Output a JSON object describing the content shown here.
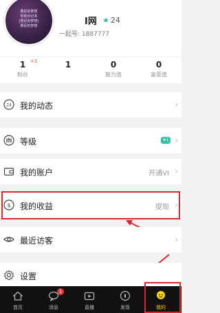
{
  "profile": {
    "nickname": "I网",
    "level": "24",
    "uid_prefix": "一起号:",
    "uid_value": "1887777",
    "avatar_text": [
      "赛尼的梦想",
      "你的日记本",
      "[赛尼的梦想]",
      "赛尼的梦想"
    ]
  },
  "stats": [
    {
      "num": "1",
      "label": "粉丝",
      "plus": "+1"
    },
    {
      "num": "1",
      "label": ""
    },
    {
      "num": "0",
      "label": "魅力值"
    },
    {
      "num": "0",
      "label": "富豪值"
    }
  ],
  "menu": {
    "dynamics": "我的动态",
    "level": "等级",
    "level_badge": "★1",
    "account": "我的账户",
    "account_right": "开通VI",
    "income": "我的收益",
    "income_right": "提现",
    "visitors": "最近访客",
    "settings": "设置"
  },
  "tabs": [
    {
      "label": "首页"
    },
    {
      "label": "消息",
      "badge": "1"
    },
    {
      "label": "直播"
    },
    {
      "label": "发现"
    },
    {
      "label": "我的"
    }
  ],
  "colors": {
    "accent": "#ffd600",
    "highlight": "#d8282a",
    "tabbar": "#111111"
  }
}
